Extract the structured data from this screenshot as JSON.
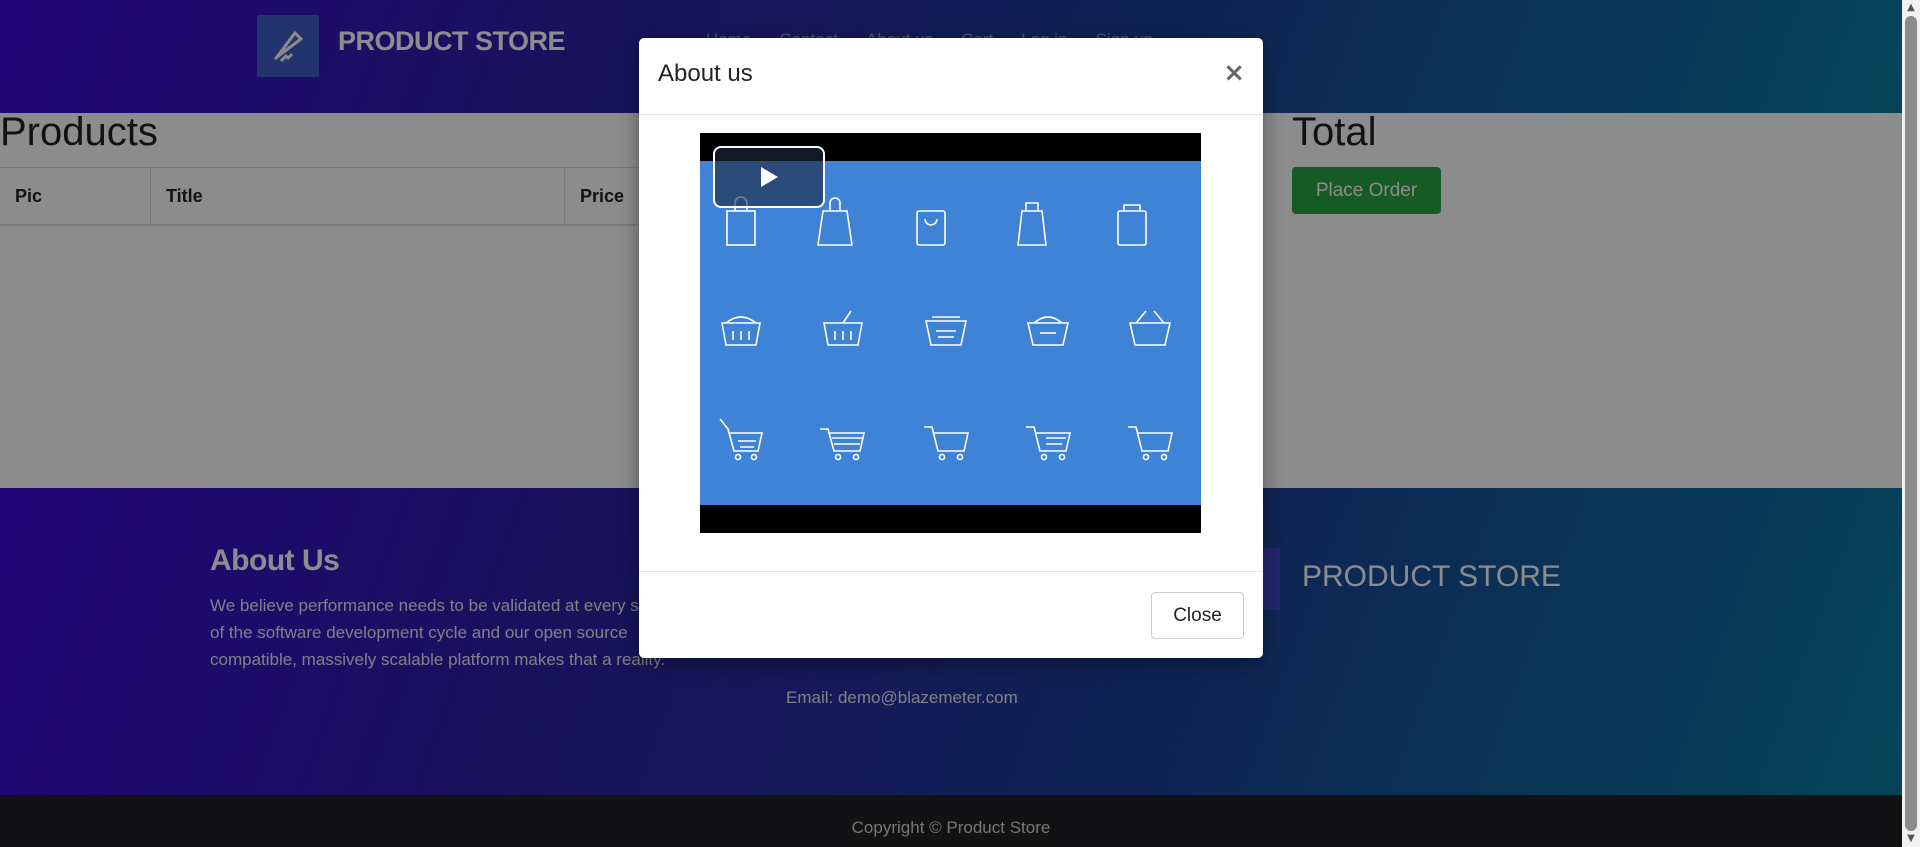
{
  "navbar": {
    "brand": "PRODUCT STORE",
    "links": [
      "Home",
      "Contact",
      "About us",
      "Cart",
      "Log in",
      "Sign up"
    ]
  },
  "products": {
    "title": "Products",
    "columns": [
      "Pic",
      "Title",
      "Price"
    ]
  },
  "total": {
    "title": "Total",
    "place_order_label": "Place Order"
  },
  "footer": {
    "about_title": "About Us",
    "about_text": "We believe performance needs to be validated at every stage of the software development cycle and our open source compatible, massively scalable platform makes that a reality.",
    "email": "Email: demo@blazemeter.com",
    "brand": "PRODUCT STORE",
    "copyright": "Copyright © Product Store"
  },
  "modal": {
    "title": "About us",
    "close_x": "×",
    "close_label": "Close",
    "video": {
      "state": "paused",
      "icons": [
        [
          "shopping-bag-icon",
          "shopping-bag-icon",
          "shopping-bag-icon",
          "shopping-bag-icon",
          "shopping-bag-icon"
        ],
        [
          "basket-icon",
          "basket-icon",
          "basket-icon",
          "basket-icon",
          "basket-icon"
        ],
        [
          "shopping-cart-icon",
          "shopping-cart-icon",
          "shopping-cart-icon",
          "shopping-cart-icon",
          "shopping-cart-icon"
        ]
      ]
    }
  },
  "colors": {
    "accent_green": "#28a745",
    "video_blue": "#3f83d6",
    "gradient_start": "#3a0bd8",
    "gradient_end": "#0a7ea0"
  }
}
